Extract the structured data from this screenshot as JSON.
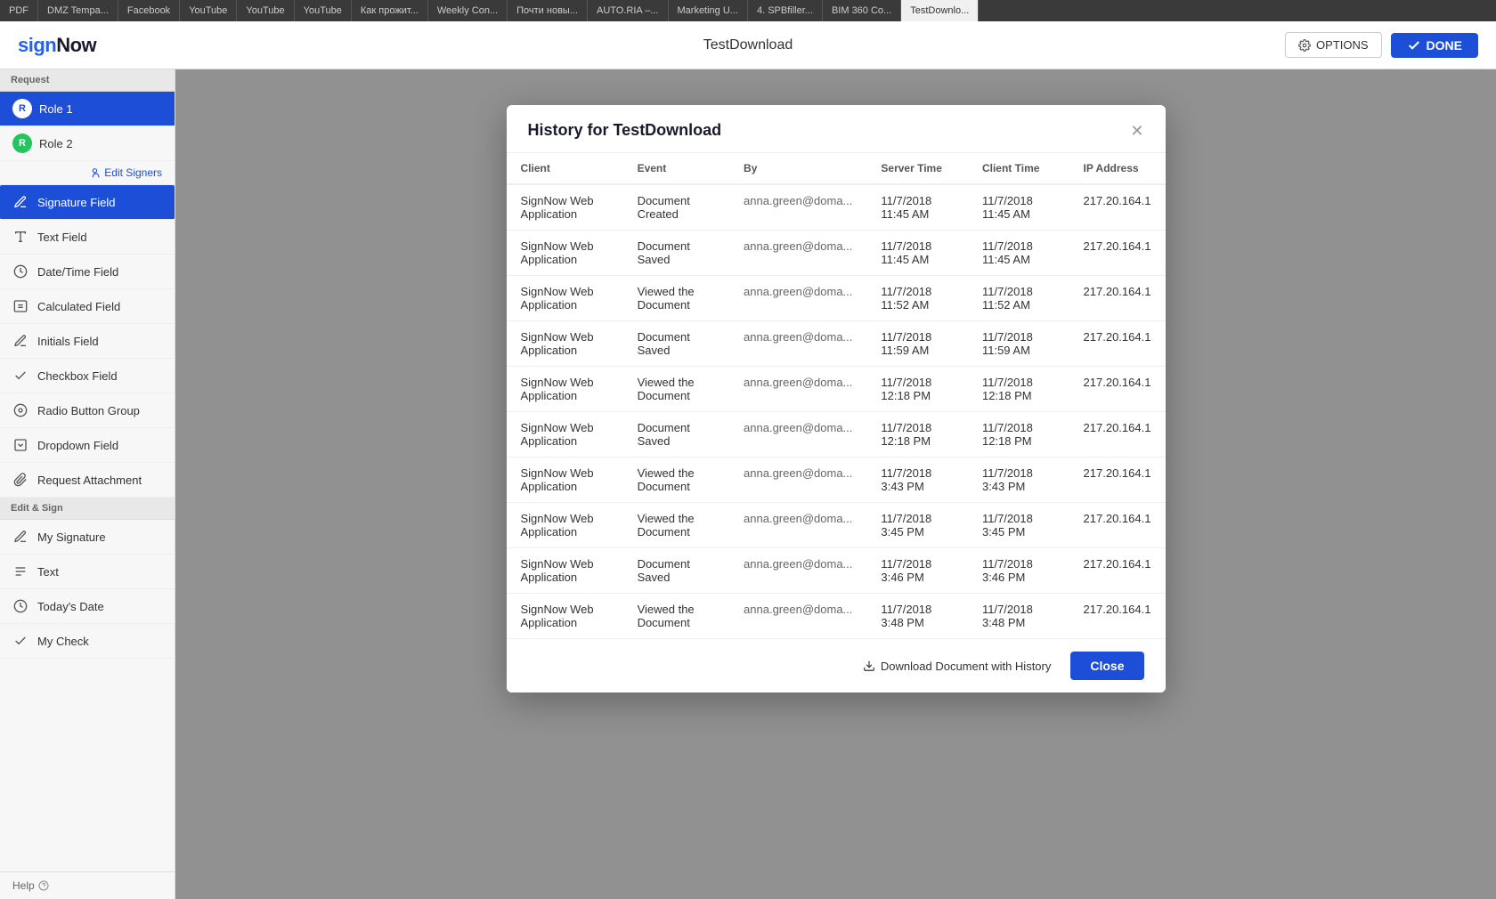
{
  "browser": {
    "tabs": [
      {
        "label": "PDF",
        "active": false
      },
      {
        "label": "DMZ Tempa...",
        "active": false
      },
      {
        "label": "Facebook",
        "active": false
      },
      {
        "label": "YouTube",
        "active": false
      },
      {
        "label": "YouTube",
        "active": false
      },
      {
        "label": "YouTube",
        "active": false
      },
      {
        "label": "Как прожит...",
        "active": false
      },
      {
        "label": "Weekly Con...",
        "active": false
      },
      {
        "label": "Почти новы...",
        "active": false
      },
      {
        "label": "AUTO.RIA –...",
        "active": false
      },
      {
        "label": "Marketing U...",
        "active": false
      },
      {
        "label": "4. SPBfiller...",
        "active": false
      },
      {
        "label": "BIM 360 Co...",
        "active": false
      },
      {
        "label": "TestDownlo...",
        "active": true
      }
    ]
  },
  "header": {
    "logo": "signNow",
    "title": "TestDownload",
    "options_label": "OPTIONS",
    "done_label": "DONE"
  },
  "sidebar": {
    "request_section": "Request",
    "roles": [
      {
        "label": "Role 1",
        "badge": "R",
        "active": true,
        "color": "role1"
      },
      {
        "label": "Role 2",
        "badge": "R",
        "active": false,
        "color": "role2"
      }
    ],
    "edit_signers": "Edit Signers",
    "request_fields": [
      {
        "label": "Signature Field",
        "icon": "pen-icon"
      },
      {
        "label": "Text Field",
        "icon": "text-icon"
      },
      {
        "label": "Date/Time Field",
        "icon": "clock-icon"
      },
      {
        "label": "Calculated Field",
        "icon": "calc-icon"
      },
      {
        "label": "Initials Field",
        "icon": "initials-icon"
      },
      {
        "label": "Checkbox Field",
        "icon": "check-icon"
      },
      {
        "label": "Radio Button Group",
        "icon": "radio-icon"
      },
      {
        "label": "Dropdown Field",
        "icon": "dropdown-icon"
      },
      {
        "label": "Request Attachment",
        "icon": "attach-icon"
      }
    ],
    "edit_sign_section": "Edit & Sign",
    "edit_sign_fields": [
      {
        "label": "My Signature",
        "icon": "sig-icon"
      },
      {
        "label": "Text",
        "icon": "text2-icon"
      },
      {
        "label": "Today's Date",
        "icon": "date-icon"
      },
      {
        "label": "My Check",
        "icon": "mycheck-icon"
      }
    ],
    "help_label": "Help"
  },
  "modal": {
    "title": "History for TestDownload",
    "columns": [
      "Client",
      "Event",
      "By",
      "Server Time",
      "Client Time",
      "IP Address"
    ],
    "rows": [
      {
        "client": "SignNow Web Application",
        "event": "Document Created",
        "by": "anna.green@doma...",
        "server_time": "11/7/2018 11:45 AM",
        "client_time": "11/7/2018 11:45 AM",
        "ip": "217.20.164.1"
      },
      {
        "client": "SignNow Web Application",
        "event": "Document Saved",
        "by": "anna.green@doma...",
        "server_time": "11/7/2018 11:45 AM",
        "client_time": "11/7/2018 11:45 AM",
        "ip": "217.20.164.1"
      },
      {
        "client": "SignNow Web Application",
        "event": "Viewed the Document",
        "by": "anna.green@doma...",
        "server_time": "11/7/2018 11:52 AM",
        "client_time": "11/7/2018 11:52 AM",
        "ip": "217.20.164.1"
      },
      {
        "client": "SignNow Web Application",
        "event": "Document Saved",
        "by": "anna.green@doma...",
        "server_time": "11/7/2018 11:59 AM",
        "client_time": "11/7/2018 11:59 AM",
        "ip": "217.20.164.1"
      },
      {
        "client": "SignNow Web Application",
        "event": "Viewed the Document",
        "by": "anna.green@doma...",
        "server_time": "11/7/2018 12:18 PM",
        "client_time": "11/7/2018 12:18 PM",
        "ip": "217.20.164.1"
      },
      {
        "client": "SignNow Web Application",
        "event": "Document Saved",
        "by": "anna.green@doma...",
        "server_time": "11/7/2018 12:18 PM",
        "client_time": "11/7/2018 12:18 PM",
        "ip": "217.20.164.1"
      },
      {
        "client": "SignNow Web Application",
        "event": "Viewed the Document",
        "by": "anna.green@doma...",
        "server_time": "11/7/2018 3:43 PM",
        "client_time": "11/7/2018 3:43 PM",
        "ip": "217.20.164.1"
      },
      {
        "client": "SignNow Web Application",
        "event": "Viewed the Document",
        "by": "anna.green@doma...",
        "server_time": "11/7/2018 3:45 PM",
        "client_time": "11/7/2018 3:45 PM",
        "ip": "217.20.164.1"
      },
      {
        "client": "SignNow Web Application",
        "event": "Document Saved",
        "by": "anna.green@doma...",
        "server_time": "11/7/2018 3:46 PM",
        "client_time": "11/7/2018 3:46 PM",
        "ip": "217.20.164.1"
      },
      {
        "client": "SignNow Web Application",
        "event": "Viewed the Document",
        "by": "anna.green@doma...",
        "server_time": "11/7/2018 3:48 PM",
        "client_time": "11/7/2018 3:48 PM",
        "ip": "217.20.164.1"
      }
    ],
    "download_label": "Download Document with History",
    "close_label": "Close"
  }
}
